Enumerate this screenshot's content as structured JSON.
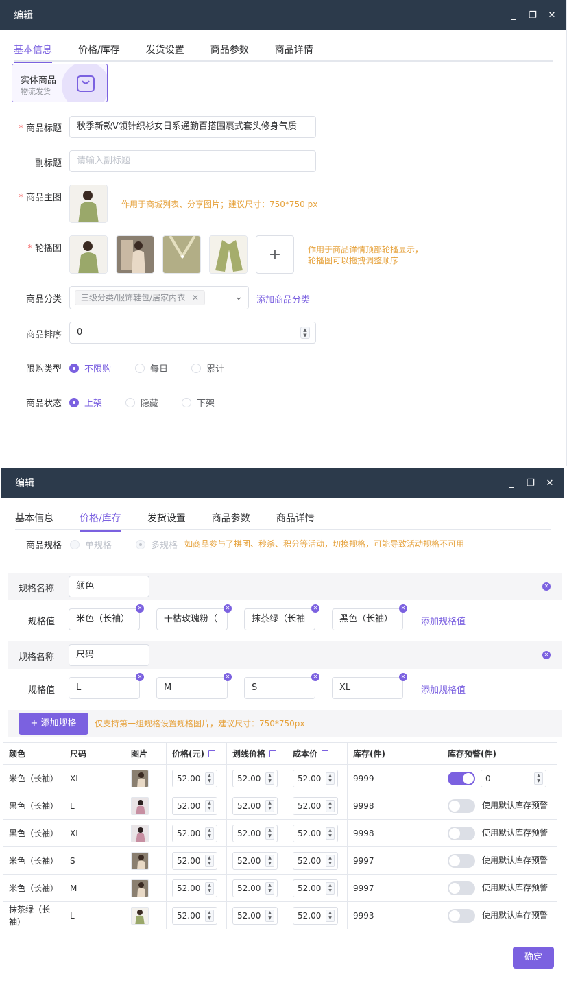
{
  "win1": {
    "title": "编辑",
    "tabs": [
      "基本信息",
      "价格/库存",
      "发货设置",
      "商品参数",
      "商品详情"
    ],
    "type_card": {
      "title": "实体商品",
      "subtitle": "物流发货"
    },
    "product_title": {
      "label": "商品标题",
      "value": "秋季新款V领针织衫女日系通勤百搭围裹式套头修身气质"
    },
    "subtitle": {
      "label": "副标题",
      "placeholder": "请输入副标题"
    },
    "main_image": {
      "label": "商品主图",
      "hint": "作用于商城列表、分享图片；建议尺寸：750*750 px"
    },
    "carousel": {
      "label": "轮播图",
      "hint_line1": "作用于商品详情顶部轮播显示，",
      "hint_line2": "轮播图可以拖拽调整顺序",
      "add": "+"
    },
    "category": {
      "label": "商品分类",
      "tag": "三级分类/服饰鞋包/居家内衣",
      "add_link": "添加商品分类"
    },
    "sort": {
      "label": "商品排序",
      "value": "0"
    },
    "limit_type": {
      "label": "限购类型",
      "options": [
        "不限购",
        "每日",
        "累计"
      ]
    },
    "status": {
      "label": "商品状态",
      "options": [
        "上架",
        "隐藏",
        "下架"
      ]
    }
  },
  "win2": {
    "title": "编辑",
    "tabs": [
      "基本信息",
      "价格/库存",
      "发货设置",
      "商品参数",
      "商品详情"
    ],
    "spec": {
      "label": "商品规格",
      "single": "单规格",
      "multi": "多规格",
      "warning": "如商品参与了拼团、秒杀、积分等活动，切换规格，可能导致活动规格不可用"
    },
    "groups": [
      {
        "name_label": "规格名称",
        "name": "颜色",
        "values_label": "规格值",
        "values": [
          "米色（长袖）",
          "干枯玫瑰粉（",
          "抹茶绿（长袖",
          "黑色（长袖）"
        ],
        "add_link": "添加规格值"
      },
      {
        "name_label": "规格名称",
        "name": "尺码",
        "values_label": "规格值",
        "values": [
          "L",
          "M",
          "S",
          "XL"
        ],
        "add_link": "添加规格值"
      }
    ],
    "add_spec_button": "+ 添加规格",
    "add_spec_hint": "仅支持第一组规格设置规格图片，建议尺寸：750*750px",
    "table": {
      "headers": [
        "颜色",
        "尺码",
        "图片",
        "价格(元)",
        "划线价格",
        "成本价",
        "库存(件)",
        "库存预警(件)"
      ],
      "rows": [
        {
          "color": "米色（长袖）",
          "size": "XL",
          "price": "52.00",
          "line_price": "52.00",
          "cost": "52.00",
          "stock": "9999",
          "warn_on": true,
          "warn_value": "0",
          "warn_text": ""
        },
        {
          "color": "黑色（长袖）",
          "size": "L",
          "price": "52.00",
          "line_price": "52.00",
          "cost": "52.00",
          "stock": "9998",
          "warn_on": false,
          "warn_value": "",
          "warn_text": "使用默认库存预警"
        },
        {
          "color": "黑色（长袖）",
          "size": "XL",
          "price": "52.00",
          "line_price": "52.00",
          "cost": "52.00",
          "stock": "9998",
          "warn_on": false,
          "warn_value": "",
          "warn_text": "使用默认库存预警"
        },
        {
          "color": "米色（长袖）",
          "size": "S",
          "price": "52.00",
          "line_price": "52.00",
          "cost": "52.00",
          "stock": "9997",
          "warn_on": false,
          "warn_value": "",
          "warn_text": "使用默认库存预警"
        },
        {
          "color": "米色（长袖）",
          "size": "M",
          "price": "52.00",
          "line_price": "52.00",
          "cost": "52.00",
          "stock": "9997",
          "warn_on": false,
          "warn_value": "",
          "warn_text": "使用默认库存预警"
        },
        {
          "color": "抹茶绿（长袖）",
          "size": "L",
          "price": "52.00",
          "line_price": "52.00",
          "cost": "52.00",
          "stock": "9993",
          "warn_on": false,
          "warn_value": "",
          "warn_text": "使用默认库存预警"
        }
      ]
    },
    "confirm": "确定"
  },
  "colors": {
    "accent": "#7b61e0",
    "titlebar": "#2c3a4b",
    "warning": "#e6a23c",
    "required": "#f56c6c"
  }
}
